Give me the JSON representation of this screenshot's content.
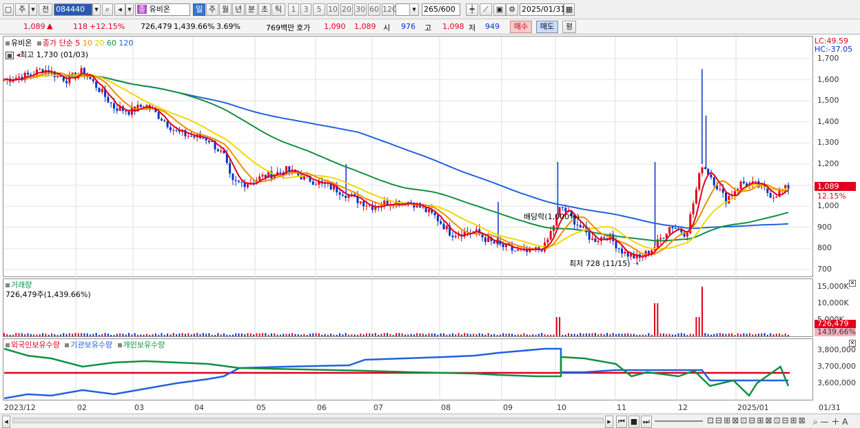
{
  "toolbar": {
    "period_label": "주",
    "prev_label": "전",
    "code": "084440",
    "name": "유비온",
    "name_prefix": "종",
    "intervals": [
      "일",
      "주",
      "월",
      "년",
      "분",
      "초",
      "틱"
    ],
    "numbers": [
      "1",
      "3",
      "5",
      "10",
      "20",
      "30",
      "60",
      "120"
    ],
    "count": "265",
    "count_total": "/600",
    "date": "2025/01/31"
  },
  "quote": {
    "price": "1,089",
    "change": "118",
    "change_pct": "+12.15%",
    "volume": "726,479",
    "volume_pct": "1,439.66%",
    "turnover": "3.69%",
    "amount": "769백만",
    "bid_label": "호가",
    "bid1": "1,090",
    "bid2": "1,089",
    "open_label": "시",
    "open": "976",
    "high_label": "고",
    "high": "1,098",
    "low_label": "저",
    "low": "949",
    "buy_btn": "매수",
    "sell_btn": "매도",
    "eval_btn": "평"
  },
  "price_panel": {
    "title": "유비온",
    "ma_label": "종가 단순",
    "ma_periods": [
      "5",
      "10",
      "20",
      "60",
      "120"
    ],
    "ma_colors": [
      "#e0001b",
      "#f08c00",
      "#f0d800",
      "#109040",
      "#2060e0"
    ],
    "high_note": "최고 1,730 (01/03)",
    "low_note": "최저 728 (11/15)",
    "dividend_note": "배당락(1,000%)",
    "lc": "LC:49.59",
    "hc": "HC:-37.05",
    "price_tag": "1,089",
    "pct_tag": "12.15%",
    "y_ticks": [
      "1,700",
      "1,600",
      "1,500",
      "1,400",
      "1,300",
      "1,200",
      "1,100",
      "1,000",
      "900",
      "800",
      "700"
    ]
  },
  "volume_panel": {
    "title": "거래량",
    "value": "726,479주(1,439.66%)",
    "y_ticks": [
      "15,000K",
      "10,000K",
      "5,000K"
    ],
    "tag": "726,479",
    "tag2": "1439.66%"
  },
  "holdings_panel": {
    "labels": [
      "외국인보유수량",
      "기관보유수량",
      "개인보유수량"
    ],
    "colors": [
      "#e0001b",
      "#2060e0",
      "#109040"
    ],
    "y_ticks": [
      "3,800,000",
      "3,700,000",
      "3,600,000"
    ]
  },
  "x_axis": [
    "2023/12",
    "02",
    "03",
    "04",
    "05",
    "06",
    "07",
    "08",
    "09",
    "10",
    "11",
    "12",
    "2025/01",
    "01/31"
  ],
  "chart_data": {
    "type": "line",
    "title": "유비온",
    "series": [
      {
        "name": "종가",
        "x": [
          "2023/12",
          "02",
          "03",
          "04",
          "05",
          "06",
          "07",
          "08",
          "09",
          "10",
          "11",
          "12",
          "2025/01",
          "01/31"
        ],
        "values": [
          1620,
          1610,
          1450,
          1320,
          1120,
          1130,
          1020,
          900,
          800,
          1010,
          860,
          900,
          1120,
          1089
        ]
      },
      {
        "name": "120",
        "values": [
          1680,
          1560,
          1430,
          1340,
          1250,
          1170,
          1080,
          990,
          930,
          890,
          890,
          910,
          910,
          910
        ]
      },
      {
        "name": "60",
        "values": [
          1620,
          1610,
          1540,
          1430,
          1300,
          1210,
          1110,
          1020,
          950,
          900,
          880,
          880,
          910,
          950
        ]
      }
    ],
    "ylim": [
      700,
      1700
    ]
  }
}
